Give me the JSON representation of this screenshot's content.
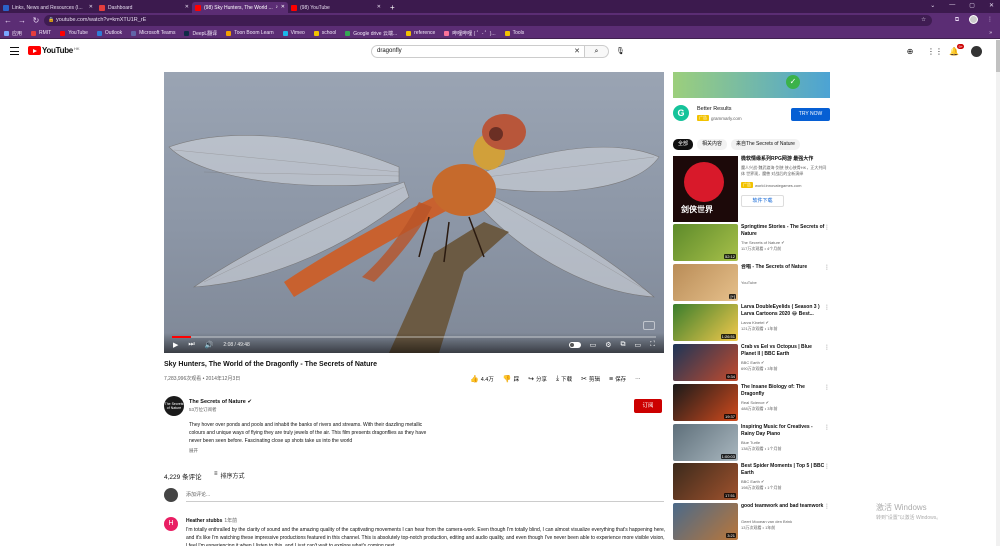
{
  "browser": {
    "tabs": [
      {
        "title": "Links, News and Resources (I...",
        "color": "#2b62c9"
      },
      {
        "title": "Dashboard",
        "color": "#e43d3d"
      },
      {
        "title": "(98) Sky Hunters, The World ...",
        "color": "#ff0000"
      },
      {
        "title": "(98) YouTube",
        "color": "#ff0000"
      }
    ],
    "new_tab": "+",
    "url": "youtube.com/watch?v=kmXTU1R_rE",
    "window_controls": [
      "⌄",
      "—",
      "▢",
      "✕"
    ],
    "bookmarks": [
      {
        "label": "应用",
        "color": "#7aa7ff"
      },
      {
        "label": "RMIT",
        "color": "#e43d3d"
      },
      {
        "label": "YouTube",
        "color": "#ff0000"
      },
      {
        "label": "Outlook",
        "color": "#2f7cd6"
      },
      {
        "label": "Microsoft Teams",
        "color": "#6264a7"
      },
      {
        "label": "DeepL翻译",
        "color": "#0f2b46"
      },
      {
        "label": "Toon Boom Learn",
        "color": "#f4a100"
      },
      {
        "label": "Vimeo",
        "color": "#1ab7ea"
      },
      {
        "label": "school",
        "color": "#f2c200"
      },
      {
        "label": "Google drive 云端...",
        "color": "#34a853"
      },
      {
        "label": "reference",
        "color": "#f2c200"
      },
      {
        "label": "哔哩哔哩 ( ゜- ゜)...",
        "color": "#fb7299"
      },
      {
        "label": "Tools",
        "color": "#f2c200"
      }
    ],
    "bookmarks_more": "»"
  },
  "youtube": {
    "logo_text": "YouTube",
    "region": "HK",
    "search_value": "dragonfly",
    "notifications": "9+"
  },
  "video": {
    "title": "Sky Hunters, The World of the Dragonfly - The Secrets of Nature",
    "meta": "7,283,996次观看 • 2014年12月3日",
    "time": "2:08 / 49:48",
    "progress": 0.04,
    "likes": "4.4万",
    "dislike_label": "踩",
    "share_label": "分享",
    "download_label": "下载",
    "clip_label": "剪辑",
    "save_label": "保存",
    "more_label": "···"
  },
  "channel": {
    "name": "The Secrets of Nature",
    "avatar_text": "The Secrets of Nature",
    "subs": "53万位订阅者",
    "subscribe_label": "订阅",
    "description": "They hover over ponds and pools and inhabit the banks of rivers and streams. With their dazzling metallic colours and unique ways of flying they are truly jewels of the air. This film presents dragonflies as they have never been seen before. Fascinating close up shots take us into the world",
    "show_more": "展开"
  },
  "comments": {
    "count": "4,229 条评论",
    "sort_label": "排序方式",
    "placeholder": "添加评论...",
    "first": {
      "avatar": "H",
      "author": "Heather stubbs",
      "time": "1年前",
      "text": "I'm totally enthralled by the clarity of sound and the amazing quality of the captivating movements I can hear from the camera-work. Even though I'm totally blind, I can almost visualize everything that's happening here, and it's like I'm watching these impressive productions featured in this channel. This is absolutely top-notch production, editing and audio quality, and even though I've never been able to experience more visible vision, I feel I'm experiencing it when I listen to this, and I just can't wait to explore what's coming next."
    }
  },
  "ad": {
    "title": "Better Results",
    "tag": "广告",
    "domain": "grammarly.com",
    "button": "TRY NOW",
    "logo": "G"
  },
  "chips": [
    "全部",
    "相关内容",
    "来自The Secrets of Nature"
  ],
  "game_ad": {
    "title": "微软情缘系列RPG网游 最强大作",
    "desc": "魔人兴战·魏武渡海·剑侠 侠心侠骨HK，正大共同体 世界观，魔兽 对战后的全新演绎",
    "tag": "广告",
    "domain": "world.innovategames.com",
    "download": "软件下载",
    "thumb_text": "剑侠世界"
  },
  "recommendations": [
    {
      "title": "Springtime Stories - The Secrets of Nature",
      "channel": "The Secrets of Nature ✔",
      "meta": "117万次观看 • 4个月前",
      "dur": "52:12",
      "c1": "#5d8a2a",
      "c2": "#a7c04a"
    },
    {
      "title": "合唱 - The Secrets of Nature",
      "channel": "YouTube",
      "meta": "",
      "dur": "[+]",
      "c1": "#b98c57",
      "c2": "#e6c08b"
    },
    {
      "title": "Larva DoubleEyelids ( Season 3 ) Larva Cartoons 2020 😂 Best...",
      "channel": "Larva Kinetel ✔",
      "meta": "121万次观看 • 1年前",
      "dur": "1:26:51",
      "c1": "#3a7d2c",
      "c2": "#f2c94c"
    },
    {
      "title": "Crab vs Eel vs Octopus | Blue Planet II | BBC Earth",
      "channel": "BBC Earth ✔",
      "meta": "690万次观看 • 3年前",
      "dur": "9:34",
      "c1": "#1d3557",
      "c2": "#c24b2e"
    },
    {
      "title": "The Insane Biology of: The Dragonfly",
      "channel": "Real Science ✔",
      "meta": "488万次观看 • 3年前",
      "dur": "19:37",
      "c1": "#1a1a1a",
      "c2": "#d04a1d"
    },
    {
      "title": "Inspiring Music for Creatives - Rainy Day Piano",
      "channel": "Blue Turtle",
      "meta": "138万次观看 • 1个月前",
      "dur": "1:00:03",
      "c1": "#5e6f7a",
      "c2": "#a9b7bf"
    },
    {
      "title": "Best Spider Moments | Top 5 | BBC Earth",
      "channel": "BBC Earth ✔",
      "meta": "198万次观看 • 1个月前",
      "dur": "17:51",
      "c1": "#3b2a1c",
      "c2": "#a0522d"
    },
    {
      "title": "good teamwork and bad teamwork",
      "channel": "Geert Mooean van den Brink",
      "meta": "13万次观看 • 1年前",
      "dur": "3:21",
      "c1": "#4a6a8a",
      "c2": "#b9763a"
    }
  ],
  "windows": {
    "line1": "激活 Windows",
    "line2": "转到\"设置\"以激活 Windows。"
  }
}
